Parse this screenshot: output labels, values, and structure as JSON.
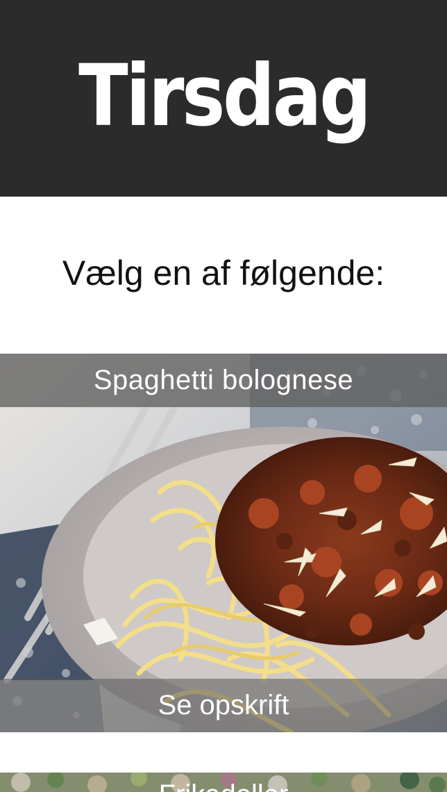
{
  "header": {
    "title": "Tirsdag"
  },
  "prompt": {
    "text": "Vælg en af følgende:"
  },
  "recipes": [
    {
      "title": "Spaghetti bolognese",
      "button_label": "Se opskrift",
      "image": "spaghetti-bolognese-photo"
    },
    {
      "title": "Frikadeller",
      "image": "salad-photo"
    }
  ],
  "colors": {
    "header_bg": "#2b2b2b",
    "header_text": "#ffffff",
    "overlay_bar": "#5f5f5f",
    "page_bg": "#ffffff"
  }
}
